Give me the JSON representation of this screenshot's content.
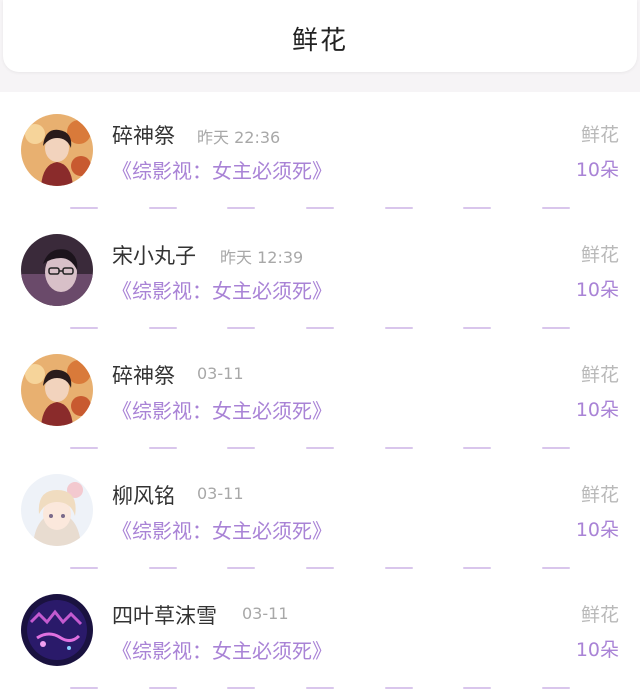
{
  "header": {
    "title": "鲜花"
  },
  "rows": [
    {
      "name": "碎神祭",
      "time": "昨天 22:36",
      "book": "《综影视：女主必须死》",
      "gift": "鲜花",
      "count": "10朵"
    },
    {
      "name": "宋小丸子",
      "time": "昨天 12:39",
      "book": "《综影视：女主必须死》",
      "gift": "鲜花",
      "count": "10朵"
    },
    {
      "name": "碎神祭",
      "time": "03-11",
      "book": "《综影视：女主必须死》",
      "gift": "鲜花",
      "count": "10朵"
    },
    {
      "name": "柳风铭",
      "time": "03-11",
      "book": "《综影视：女主必须死》",
      "gift": "鲜花",
      "count": "10朵"
    },
    {
      "name": "四叶草沫雪",
      "time": "03-11",
      "book": "《综影视：女主必须死》",
      "gift": "鲜花",
      "count": "10朵"
    }
  ],
  "colors": {
    "accent": "#a983d6",
    "muted": "#a8a8a8"
  }
}
